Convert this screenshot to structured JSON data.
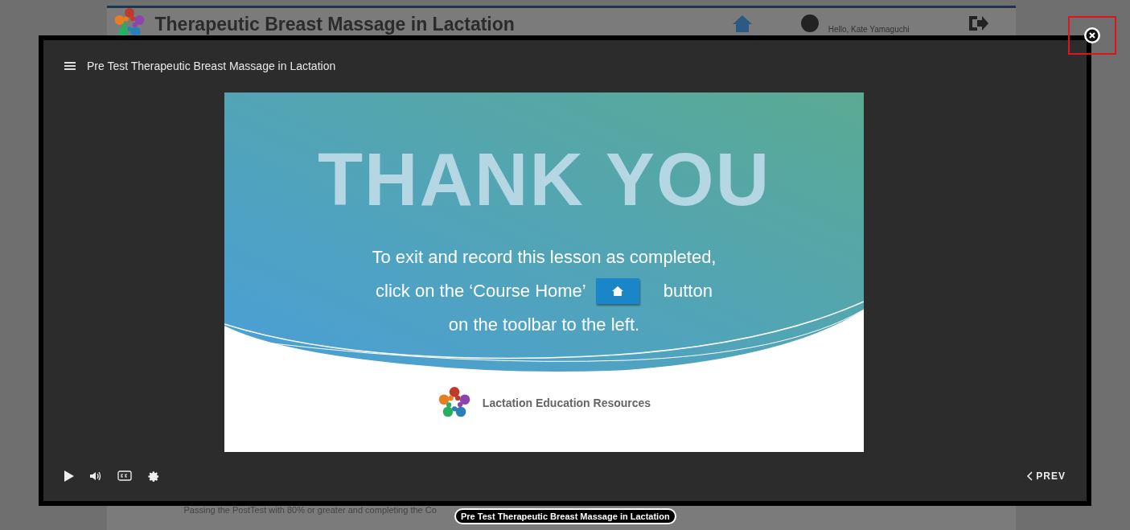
{
  "page": {
    "title": "Therapeutic Breast Massage in Lactation",
    "greeting": "Hello, Kate Yamaguchi",
    "note": "Passing the PostTest with 80% or greater and completing the Co"
  },
  "player": {
    "title": "Pre Test Therapeutic Breast Massage in Lactation",
    "prev": "PREV",
    "close_highlighted": true
  },
  "slide": {
    "heading": "THANK YOU",
    "lines": [
      {
        "kind": "text",
        "text": "To exit and record this lesson as completed,"
      },
      {
        "kind": "button",
        "text": "click on the ‘Course Home’",
        "after": "button"
      },
      {
        "kind": "text",
        "text": "on the toolbar to the left."
      }
    ],
    "brand": "Lactation Education Resources"
  },
  "tooltip": "Pre Test Therapeutic Breast Massage in Lactation"
}
